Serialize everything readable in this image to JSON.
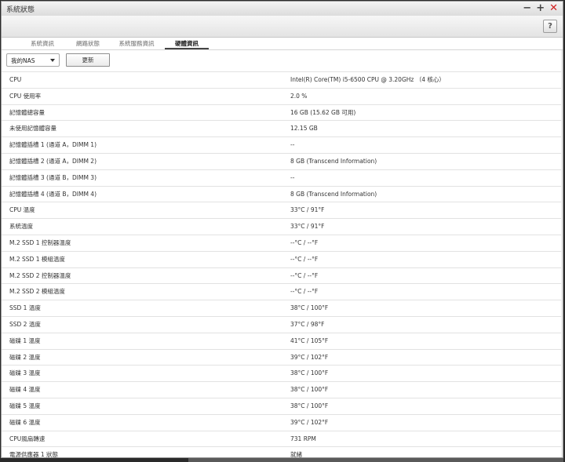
{
  "window": {
    "title": "系統狀態"
  },
  "window_buttons": {
    "minimize": "−",
    "maximize": "+",
    "close": "✕"
  },
  "help": {
    "label": "?"
  },
  "tabs": [
    {
      "label": "系統資訊"
    },
    {
      "label": "網路狀態"
    },
    {
      "label": "系統服務資訊"
    },
    {
      "label": "硬體資訊"
    }
  ],
  "controls": {
    "nas_select": "我的NAS",
    "refresh_label": "更新"
  },
  "rows": [
    {
      "label": "CPU",
      "value": "Intel(R) Core(TM) i5-6500 CPU @ 3.20GHz （4 核心）"
    },
    {
      "label": "CPU 使用率",
      "value": "2.0 %"
    },
    {
      "label": "記憶體總容量",
      "value": "16 GB (15.62 GB 可用)"
    },
    {
      "label": "未使用記憶體容量",
      "value": "12.15 GB"
    },
    {
      "label": "記憶體插槽 1 (通道 A，DIMM 1)",
      "value": "--"
    },
    {
      "label": "記憶體插槽 2 (通道 A，DIMM 2)",
      "value": "8 GB (Transcend Information)"
    },
    {
      "label": "記憶體插槽 3 (通道 B，DIMM 3)",
      "value": "--"
    },
    {
      "label": "記憶體插槽 4 (通道 B，DIMM 4)",
      "value": "8 GB (Transcend Information)"
    },
    {
      "label": "CPU 溫度",
      "value": "33°C / 91°F"
    },
    {
      "label": "系統溫度",
      "value": "33°C / 91°F"
    },
    {
      "label": "M.2 SSD 1 控制器溫度",
      "value": "--°C / --°F"
    },
    {
      "label": "M.2 SSD 1 模組溫度",
      "value": "--°C / --°F"
    },
    {
      "label": "M.2 SSD 2 控制器溫度",
      "value": "--°C / --°F"
    },
    {
      "label": "M.2 SSD 2 模組溫度",
      "value": "--°C / --°F"
    },
    {
      "label": "SSD 1 溫度",
      "value": "38°C / 100°F"
    },
    {
      "label": "SSD 2 溫度",
      "value": "37°C / 98°F"
    },
    {
      "label": "磁碟 1 溫度",
      "value": "41°C / 105°F"
    },
    {
      "label": "磁碟 2 溫度",
      "value": "39°C / 102°F"
    },
    {
      "label": "磁碟 3 溫度",
      "value": "38°C / 100°F"
    },
    {
      "label": "磁碟 4 溫度",
      "value": "38°C / 100°F"
    },
    {
      "label": "磁碟 5 溫度",
      "value": "38°C / 100°F"
    },
    {
      "label": "磁碟 6 溫度",
      "value": "39°C / 102°F"
    },
    {
      "label": "CPU風扇轉速",
      "value": "731 RPM"
    },
    {
      "label": "電源供應器 1 狀態",
      "value": "就緒"
    }
  ]
}
